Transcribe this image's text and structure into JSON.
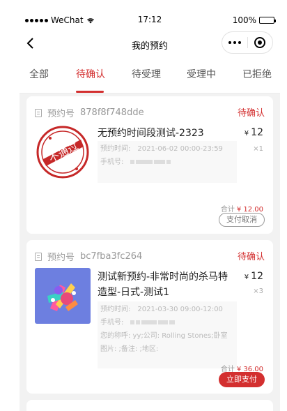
{
  "status_bar": {
    "carrier": "WeChat",
    "time": "17:12",
    "battery": "100%"
  },
  "navbar": {
    "title": "我的预约"
  },
  "tabs": [
    {
      "label": "全部"
    },
    {
      "label": "待确认",
      "active": true
    },
    {
      "label": "待受理"
    },
    {
      "label": "受理中"
    },
    {
      "label": "已拒绝"
    }
  ],
  "orders": [
    {
      "order_label": "预约号",
      "order_no": "878f8f748dde",
      "status": "待确认",
      "stamp": "不通过",
      "product": "无预约时间段测试-2323",
      "currency": "¥",
      "price": "12",
      "qty": "×1",
      "time_label": "预约时间:",
      "time_value": "2021-06-02 00:00-23:59",
      "phone_label": "手机号:",
      "total_label": "合计",
      "total": "¥ 12.00",
      "button": "支付取消"
    },
    {
      "order_label": "预约号",
      "order_no": "bc7fba3fc264",
      "status": "待确认",
      "product": "测试新预约-非常时尚的杀马特造型-日式-测试1",
      "currency": "¥",
      "price": "12",
      "qty": "×3",
      "time_label": "预约时间:",
      "time_value": "2021-03-30 09:00-12:00",
      "phone_label": "手机号:",
      "extra_text": "您的称呼: yy;公司: Rolling Stones;卧室图片: ;备注: ;地区:",
      "total_label": "合计",
      "total": "¥ 36.00",
      "button": "立即支付"
    }
  ],
  "colors": {
    "accent": "#d32f2f",
    "page_bg": "#f2f2f2"
  },
  "icons": [
    "back-arrow-icon",
    "more-icon",
    "close-capsule-icon",
    "order-doc-icon",
    "wifi-icon",
    "battery-icon"
  ]
}
